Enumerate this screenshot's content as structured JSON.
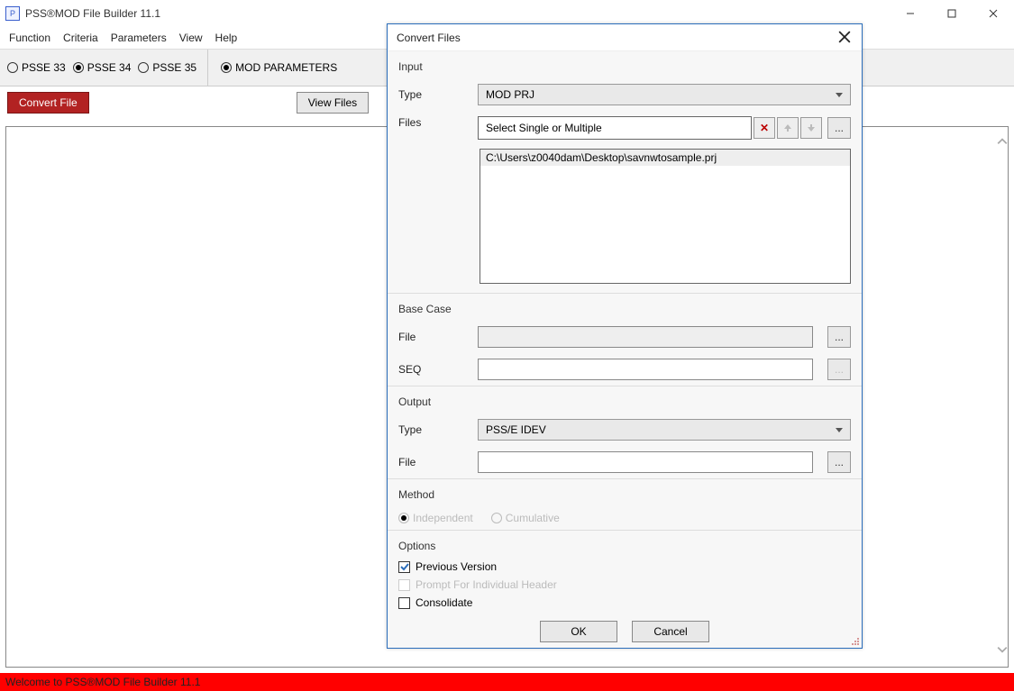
{
  "window": {
    "title": "PSS®MOD File Builder 11.1",
    "menu": [
      "Function",
      "Criteria",
      "Parameters",
      "View",
      "Help"
    ],
    "winbtns": {
      "min": "–",
      "max": "□",
      "close": "✕"
    }
  },
  "toolbar": {
    "psse": [
      {
        "label": "PSSE 33",
        "selected": false
      },
      {
        "label": "PSSE 34",
        "selected": true
      },
      {
        "label": "PSSE 35",
        "selected": false
      }
    ],
    "mod_parameters": {
      "label": "MOD PARAMETERS",
      "selected": true
    }
  },
  "buttons": {
    "convert_file": "Convert File",
    "view_files": "View Files"
  },
  "dialog": {
    "title": "Convert Files",
    "input": {
      "heading": "Input",
      "type_label": "Type",
      "type_value": "MOD PRJ",
      "files_label": "Files",
      "files_placeholder": "Select Single or Multiple",
      "browse": "...",
      "filelist": [
        "C:\\Users\\z0040dam\\Desktop\\savnwtosample.prj"
      ]
    },
    "basecase": {
      "heading": "Base Case",
      "file_label": "File",
      "seq_label": "SEQ",
      "browse": "..."
    },
    "output": {
      "heading": "Output",
      "type_label": "Type",
      "type_value": "PSS/E IDEV",
      "file_label": "File",
      "browse": "..."
    },
    "method": {
      "heading": "Method",
      "independent": "Independent",
      "cumulative": "Cumulative"
    },
    "options": {
      "heading": "Options",
      "previous_version": "Previous Version",
      "prompt_header": "Prompt For Individual Header",
      "consolidate": "Consolidate"
    },
    "ok": "OK",
    "cancel": "Cancel"
  },
  "statusbar": "Welcome to PSS®MOD File Builder 11.1"
}
